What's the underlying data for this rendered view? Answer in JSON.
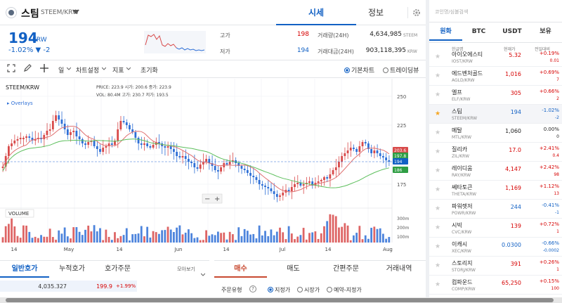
{
  "header": {
    "coin_name": "스팀",
    "pair": "STEEM/KRW",
    "tab_price": "시세",
    "tab_info": "정보"
  },
  "price": {
    "value": "194",
    "unit": "KRW",
    "change": "-1.02% ▼ -2",
    "high_label": "고가",
    "high_value": "198",
    "low_label": "저가",
    "low_value": "194",
    "vol_label": "거래량(24H)",
    "vol_value": "4,634,985",
    "vol_unit": "STEEM",
    "amt_label": "거래대금(24H)",
    "amt_value": "903,118,395",
    "amt_unit": "KRW"
  },
  "toolbar": {
    "period": "일",
    "chart_settings": "차트설정",
    "indicator": "지표",
    "reset": "초기화",
    "basic_chart": "기본차트",
    "tradingview": "트레이딩뷰"
  },
  "chart_info": {
    "symbol": "STEEM/KRW",
    "overlays": "Overlays",
    "price_label": "PRICE:",
    "price": "223.9",
    "open_label": "시가:",
    "open": "200.6",
    "close_label": "종가:",
    "close": "223.9",
    "vol_label": "VOL:",
    "vol": "80.4M",
    "high_label": "고가:",
    "high": "230.7",
    "low_label": "저가:",
    "low": "193.5",
    "volume_label": "VOLUME"
  },
  "chart_data": {
    "type": "candlestick",
    "y_ticks": [
      "250",
      "225",
      "200",
      "175"
    ],
    "volume_ticks": [
      "300m",
      "200m",
      "100m"
    ],
    "x_ticks": [
      "14",
      "May",
      "14",
      "Jun",
      "14",
      "Jul",
      "14",
      "Aug"
    ],
    "price_tags": [
      {
        "value": "203.6",
        "color": "#d84a4a"
      },
      {
        "value": "197.8",
        "color": "#2f9e44"
      },
      {
        "value": "194",
        "color": "#1261c4"
      },
      {
        "value": "186",
        "color": "#2f9e44"
      }
    ],
    "colors": {
      "up": "#d84a4a",
      "down": "#2e6fd6",
      "ma_short": "#e07070",
      "ma_long": "#5cbf5c"
    }
  },
  "bottom_left": {
    "tabs": [
      "일반호가",
      "누적호가",
      "호가주문"
    ],
    "group": "모아보기",
    "row_qty": "4,035.327",
    "row_price": "199.9",
    "row_pct": "+1.99%"
  },
  "bottom_right": {
    "tabs": [
      "매수",
      "매도",
      "간편주문",
      "거래내역"
    ],
    "order_type": "주문유형",
    "limit": "지정가",
    "market": "시장가",
    "reserve": "예약-지정가"
  },
  "side": {
    "search_placeholder": "코인명/심볼검색",
    "tabs": [
      "원화",
      "BTC",
      "USDT",
      "보유"
    ],
    "cols": {
      "name": "한글명",
      "price": "현재가",
      "change": "전일대비"
    },
    "rows": [
      {
        "name": "아이오에스티",
        "pair": "IOST/KRW",
        "price": "5.32",
        "pct": "+0.19%",
        "chg": "0.01",
        "dir": "up",
        "fav": false
      },
      {
        "name": "에드벤처골드",
        "pair": "AGLD/KRW",
        "price": "1,016",
        "pct": "+0.69%",
        "chg": "7",
        "dir": "up",
        "fav": false
      },
      {
        "name": "엘프",
        "pair": "ELF/KRW",
        "price": "305",
        "pct": "+0.66%",
        "chg": "2",
        "dir": "up",
        "fav": false
      },
      {
        "name": "스팀",
        "pair": "STEEM/KRW",
        "price": "194",
        "pct": "-1.02%",
        "chg": "-2",
        "dir": "dn",
        "fav": true
      },
      {
        "name": "메탈",
        "pair": "MTL/KRW",
        "price": "1,060",
        "pct": "0.00%",
        "chg": "0",
        "dir": "flat",
        "fav": false
      },
      {
        "name": "질리카",
        "pair": "ZIL/KRW",
        "price": "17.0",
        "pct": "+2.41%",
        "chg": "0.4",
        "dir": "up",
        "fav": false
      },
      {
        "name": "레이디움",
        "pair": "RAY/KRW",
        "price": "4,147",
        "pct": "+2.42%",
        "chg": "98",
        "dir": "up",
        "fav": false
      },
      {
        "name": "쎄타토큰",
        "pair": "THETA/KRW",
        "price": "1,169",
        "pct": "+1.12%",
        "chg": "13",
        "dir": "up",
        "fav": false
      },
      {
        "name": "파워렛저",
        "pair": "POWR/KRW",
        "price": "244",
        "pct": "-0.41%",
        "chg": "-1",
        "dir": "dn",
        "fav": false
      },
      {
        "name": "시빅",
        "pair": "CVC/KRW",
        "price": "139",
        "pct": "+0.72%",
        "chg": "1",
        "dir": "up",
        "fav": false
      },
      {
        "name": "이캐시",
        "pair": "XEC/KRW",
        "price": "0.0300",
        "pct": "-0.66%",
        "chg": "-0.0002",
        "dir": "dn",
        "fav": false
      },
      {
        "name": "스토리지",
        "pair": "STORJ/KRW",
        "price": "391",
        "pct": "+0.26%",
        "chg": "1",
        "dir": "up",
        "fav": false
      },
      {
        "name": "컴파운드",
        "pair": "COMP/KRW",
        "price": "65,250",
        "pct": "+0.15%",
        "chg": "100",
        "dir": "up",
        "fav": false
      }
    ]
  }
}
